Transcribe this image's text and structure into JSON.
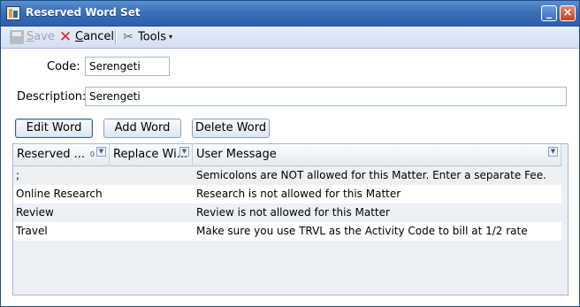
{
  "window": {
    "title": "Reserved Word Set",
    "minimize_label": "_",
    "close_label": "×"
  },
  "toolbar": {
    "save_prefix": "",
    "save_mnemonic": "S",
    "save_rest": "ave",
    "cancel_mnemonic": "C",
    "cancel_rest": "ancel",
    "tools_label": "Tools",
    "tools_caret": "▾",
    "cancel_icon": "✕",
    "tools_icon": "✂"
  },
  "form": {
    "code_label": "Code:",
    "code_value": "Serengeti",
    "description_label": "Description:",
    "description_value": "Serengeti"
  },
  "buttons": {
    "edit": "Edit Word",
    "add": "Add Word",
    "delete": "Delete Word"
  },
  "grid": {
    "columns": [
      {
        "label": "Reserved ...",
        "icon": "sort-icon"
      },
      {
        "label": "Replace Wi...",
        "icon": "filter-icon"
      },
      {
        "label": "User Message",
        "icon": "filter-icon"
      }
    ],
    "filter_glyph": "▼",
    "sort_glyph": "0",
    "rows": [
      {
        "word": ";",
        "replace": "",
        "message": "Semicolons are NOT allowed for this Matter.  Enter a separate Fee."
      },
      {
        "word": "Online Research",
        "replace": "",
        "message": "Research is not allowed for this Matter"
      },
      {
        "word": "Review",
        "replace": "",
        "message": "Review is not allowed for this Matter"
      },
      {
        "word": "Travel",
        "replace": "",
        "message": "Make sure you use TRVL as the Activity Code to bill at 1/2 rate"
      }
    ]
  },
  "colors": {
    "titlebar": "#3a6fb9",
    "close": "#c2401f",
    "grid_bg": "#ecf0f5"
  }
}
